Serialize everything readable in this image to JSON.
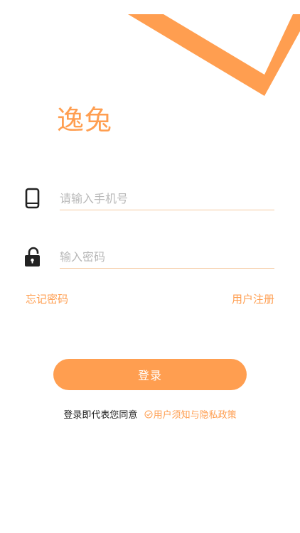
{
  "brand": {
    "title": "逸兔"
  },
  "colors": {
    "accent": "#FF9E50",
    "underline": "#F5C89E",
    "icon_dark": "#222222",
    "text_dark": "#222222",
    "placeholder": "#B8B8B8",
    "button_text": "#FFFFFF"
  },
  "form": {
    "phone": {
      "icon": "mobile-phone-icon",
      "value": "",
      "placeholder": "请输入手机号"
    },
    "password": {
      "icon": "unlocked-padlock-icon",
      "value": "",
      "placeholder": "输入密码"
    }
  },
  "links": {
    "forgot_password": "忘记密码",
    "register": "用户注册"
  },
  "login_button": {
    "label": "登录"
  },
  "agreement": {
    "prefix": "登录即代表您同意",
    "check_icon": "check-circle-icon",
    "policy_link": "用户须知与隐私政策"
  }
}
